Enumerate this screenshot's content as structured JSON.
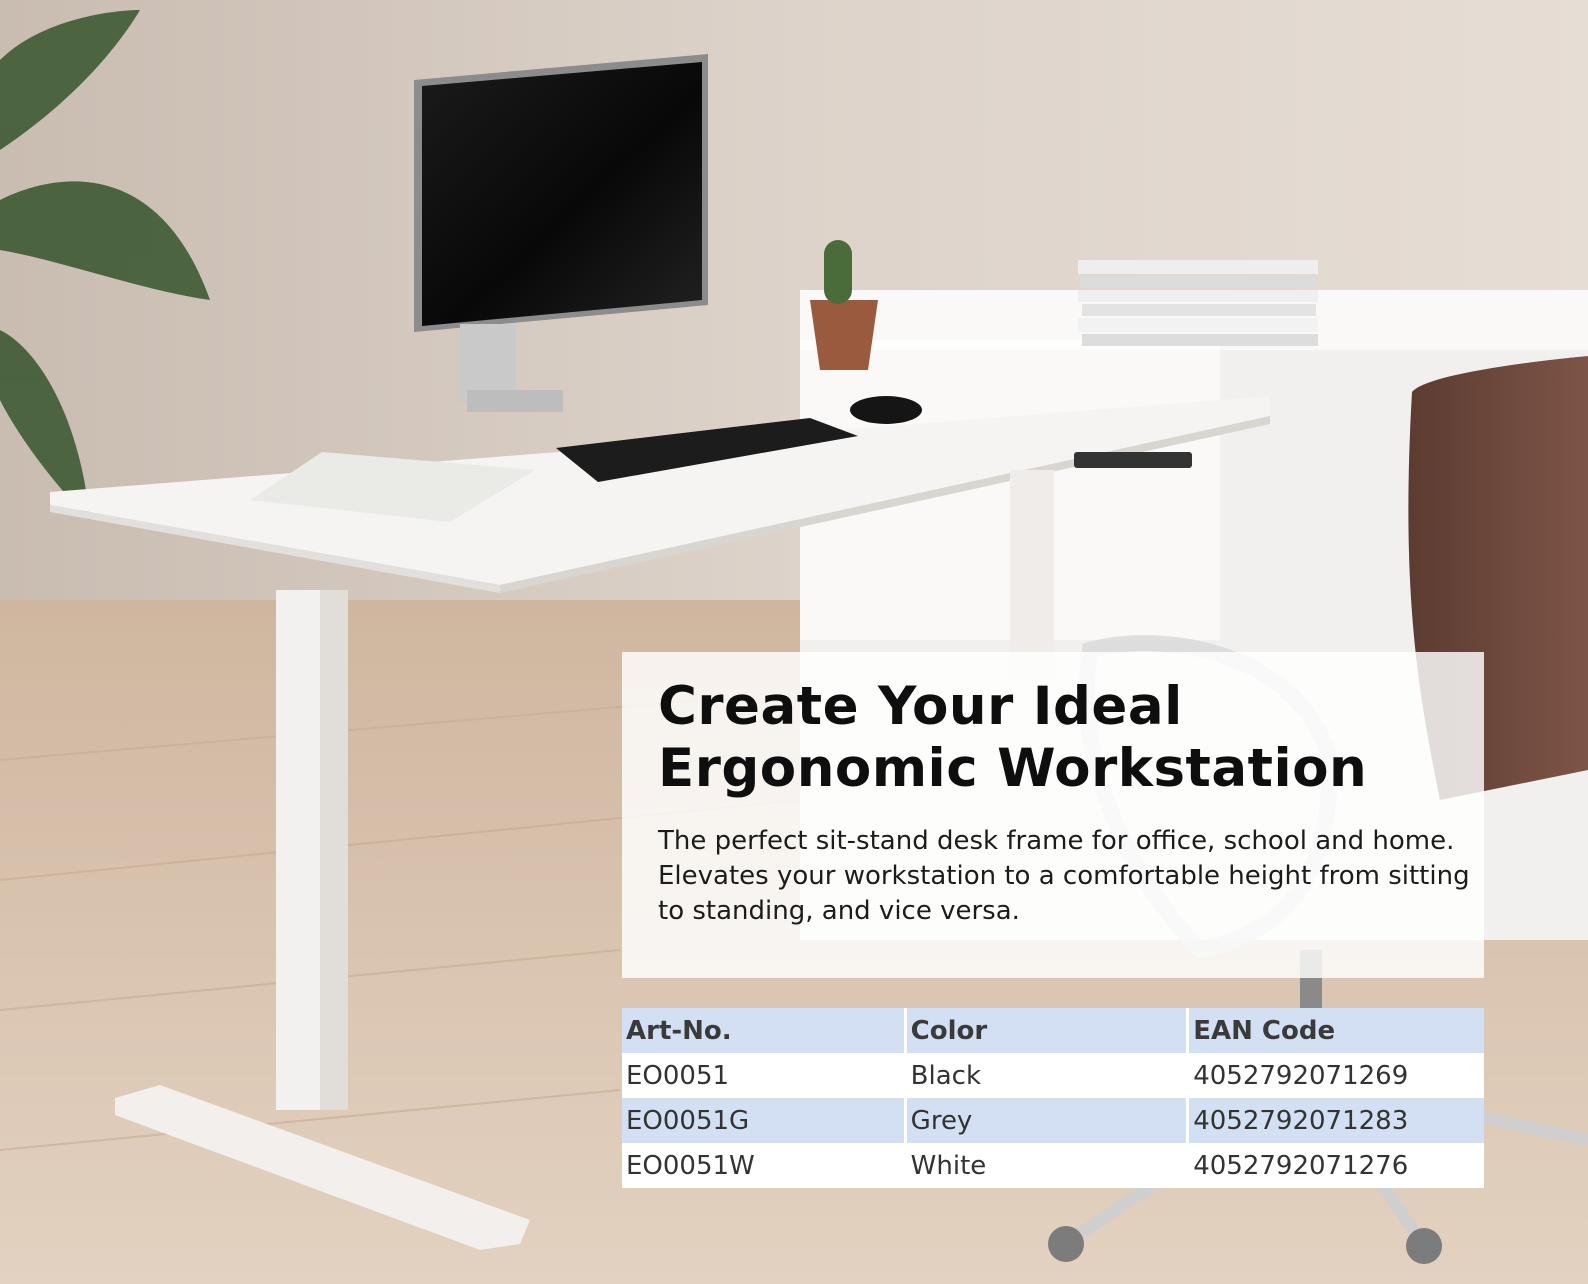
{
  "headline": {
    "line1": "Create Your Ideal",
    "line2": "Ergonomic Workstation"
  },
  "description": {
    "line1": "The perfect sit-stand desk frame for office, school and home.",
    "line2": "Elevates your workstation to a comfortable height from sitting",
    "line3": "to standing, and vice versa."
  },
  "table": {
    "headers": [
      "Art-No.",
      "Color",
      "EAN Code"
    ],
    "rows": [
      [
        "EO0051",
        "Black",
        "4052792071269"
      ],
      [
        "EO0051G",
        "Grey",
        "4052792071283"
      ],
      [
        "EO0051W",
        "White",
        "4052792071276"
      ]
    ]
  },
  "colors": {
    "header_row": "#d3dff2",
    "alt_row": "#d3dff2",
    "panel": "#ffffff"
  }
}
